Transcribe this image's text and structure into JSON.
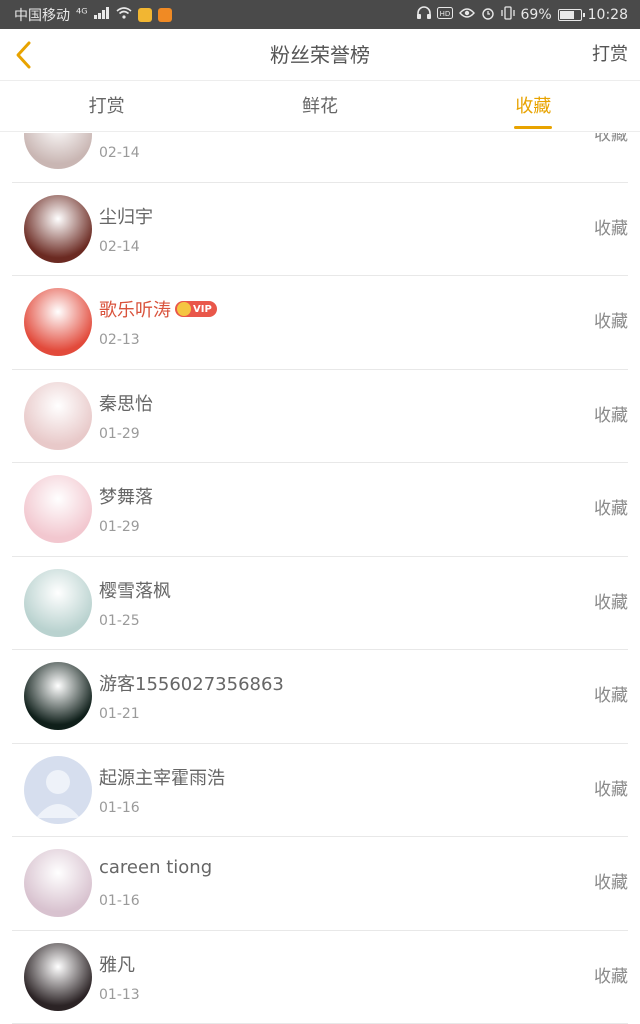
{
  "status_bar": {
    "carrier": "中国移动",
    "network": "⁴ᴳ",
    "battery_percent": "69%",
    "battery_level": 0.69,
    "time": "10:28"
  },
  "header": {
    "title": "粉丝荣誉榜",
    "action_label": "打赏",
    "back_icon": "chevron-left-icon"
  },
  "tabs": [
    {
      "label": "打赏",
      "active": false
    },
    {
      "label": "鲜花",
      "active": false
    },
    {
      "label": "收藏",
      "active": true
    }
  ],
  "colors": {
    "accent": "#e8a300",
    "vip_name": "#d9533c",
    "status_bar": "#4a4a4a"
  },
  "fans": [
    {
      "name": "",
      "date": "02-14",
      "action": "收藏",
      "vip": false,
      "avatar_color": "#c9b6b3"
    },
    {
      "name": "尘归宇",
      "date": "02-14",
      "action": "收藏",
      "vip": false,
      "avatar_color": "#6b2a22"
    },
    {
      "name": "歌乐听涛",
      "date": "02-13",
      "action": "收藏",
      "vip": true,
      "vip_label": "VIP",
      "avatar_color": "#e24a3b"
    },
    {
      "name": "秦思怡",
      "date": "01-29",
      "action": "收藏",
      "vip": false,
      "avatar_color": "#e8c9c9"
    },
    {
      "name": "梦舞落",
      "date": "01-29",
      "action": "收藏",
      "vip": false,
      "avatar_color": "#f2c7cf"
    },
    {
      "name": "樱雪落枫",
      "date": "01-25",
      "action": "收藏",
      "vip": false,
      "avatar_color": "#b9d2cf"
    },
    {
      "name": "游客1556027356863",
      "date": "01-21",
      "action": "收藏",
      "vip": false,
      "avatar_color": "#0f1f1a"
    },
    {
      "name": "起源主宰霍雨浩",
      "date": "01-16",
      "action": "收藏",
      "vip": false,
      "avatar_color": "#cdd6ea"
    },
    {
      "name": "careen tiong",
      "date": "01-16",
      "action": "收藏",
      "vip": false,
      "avatar_color": "#d8c2cf"
    },
    {
      "name": "雅凡",
      "date": "01-13",
      "action": "收藏",
      "vip": false,
      "avatar_color": "#2b2325"
    }
  ]
}
